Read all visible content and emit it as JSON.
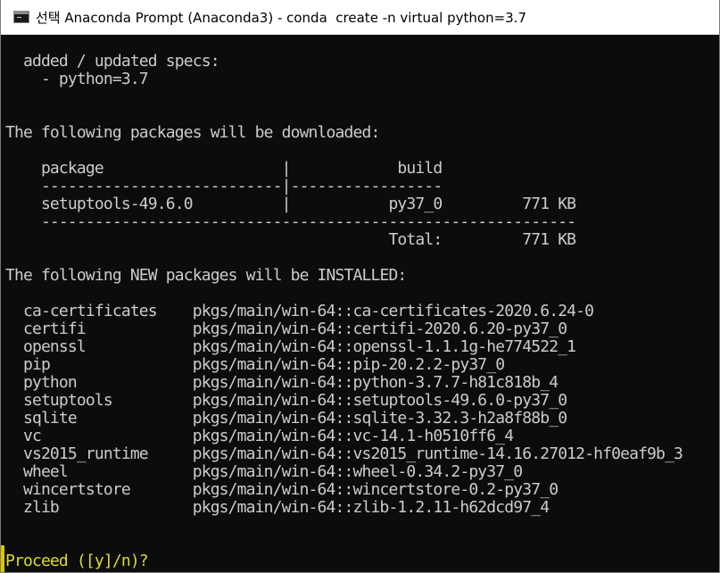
{
  "window": {
    "title": "선택 Anaconda Prompt (Anaconda3) - conda  create -n virtual python=3.7",
    "icon": "terminal-icon"
  },
  "console": {
    "lines": [
      "  added / updated specs:",
      "    - python=3.7",
      "",
      "",
      "The following packages will be downloaded:",
      "",
      "    package                    |            build",
      "    ---------------------------|-----------------",
      "    setuptools-49.6.0          |           py37_0         771 KB",
      "    ------------------------------------------------------------",
      "                                           Total:         771 KB",
      "",
      "The following NEW packages will be INSTALLED:",
      "",
      "  ca-certificates    pkgs/main/win-64::ca-certificates-2020.6.24-0",
      "  certifi            pkgs/main/win-64::certifi-2020.6.20-py37_0",
      "  openssl            pkgs/main/win-64::openssl-1.1.1g-he774522_1",
      "  pip                pkgs/main/win-64::pip-20.2.2-py37_0",
      "  python             pkgs/main/win-64::python-3.7.7-h81c818b_4",
      "  setuptools         pkgs/main/win-64::setuptools-49.6.0-py37_0",
      "  sqlite             pkgs/main/win-64::sqlite-3.32.3-h2a8f88b_0",
      "  vc                 pkgs/main/win-64::vc-14.1-h0510ff6_4",
      "  vs2015_runtime     pkgs/main/win-64::vs2015_runtime-14.16.27012-hf0eaf9b_3",
      "  wheel              pkgs/main/win-64::wheel-0.34.2-py37_0",
      "  wincertstore       pkgs/main/win-64::wincertstore-0.2-py37_0",
      "  zlib               pkgs/main/win-64::zlib-1.2.11-h62dcd97_4"
    ],
    "prompt": "Proceed ([y]/n)?"
  },
  "colors": {
    "background": "#0c0c0c",
    "text": "#cccccc",
    "prompt_text": "#dcdc32"
  }
}
